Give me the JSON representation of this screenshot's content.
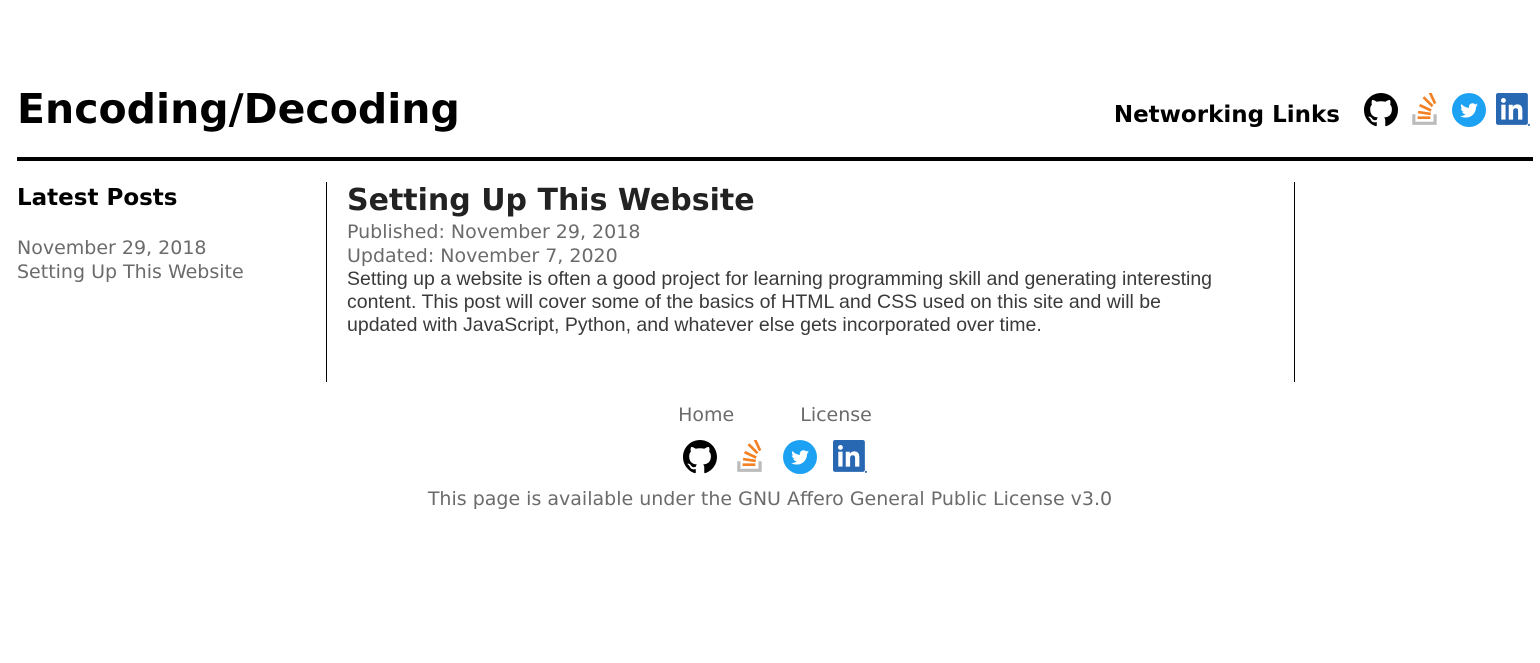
{
  "header": {
    "title": "Encoding/Decoding",
    "networking_label": "Networking Links",
    "icons": [
      "github-icon",
      "stackoverflow-icon",
      "twitter-icon",
      "linkedin-icon"
    ]
  },
  "sidebar": {
    "heading": "Latest Posts",
    "posts": [
      {
        "date": "November 29, 2018",
        "title": "Setting Up This Website"
      }
    ]
  },
  "article": {
    "title": "Setting Up This Website",
    "published": "Published: November 29, 2018",
    "updated": "Updated: November 7, 2020",
    "body": "Setting up a website is often a good project for learning programming skill and generating interesting content. This post will cover some of the basics of HTML and CSS used on this site and will be updated with JavaScript, Python, and whatever else gets incorporated over time."
  },
  "footer": {
    "nav": [
      "Home",
      "License"
    ],
    "license_text": "This page is available under the GNU Affero General Public License v3.0"
  },
  "colors": {
    "github": "#000000",
    "stackoverflow_orange": "#f48024",
    "stackoverflow_gray": "#bcbbbb",
    "twitter": "#1da1f2",
    "linkedin": "#2867b2",
    "muted_text": "#6b6b6b"
  }
}
